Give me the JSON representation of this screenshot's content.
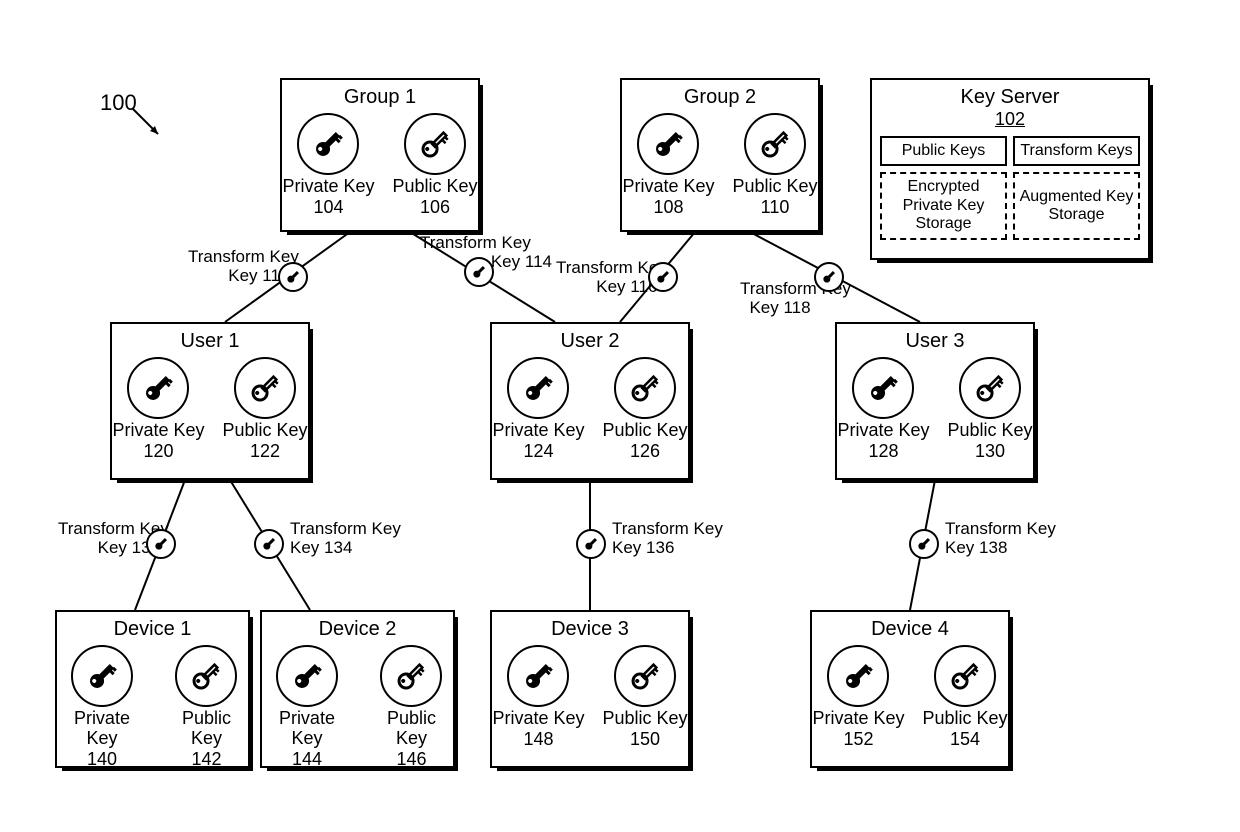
{
  "figure_number": "100",
  "key_server": {
    "title": "Key Server",
    "ref": "102",
    "cells": [
      "Public Keys",
      "Transform Keys",
      "Encrypted Private Key Storage",
      "Augmented Key Storage"
    ]
  },
  "labels": {
    "private_key": "Private Key",
    "public_key": "Public Key",
    "transform_key": "Transform Key"
  },
  "entities": {
    "group1": {
      "title": "Group 1",
      "priv": "104",
      "pub": "106"
    },
    "group2": {
      "title": "Group 2",
      "priv": "108",
      "pub": "110"
    },
    "user1": {
      "title": "User 1",
      "priv": "120",
      "pub": "122"
    },
    "user2": {
      "title": "User 2",
      "priv": "124",
      "pub": "126"
    },
    "user3": {
      "title": "User 3",
      "priv": "128",
      "pub": "130"
    },
    "device1": {
      "title": "Device 1",
      "priv": "140",
      "pub": "142"
    },
    "device2": {
      "title": "Device 2",
      "priv": "144",
      "pub": "146"
    },
    "device3": {
      "title": "Device 3",
      "priv": "148",
      "pub": "150"
    },
    "device4": {
      "title": "Device 4",
      "priv": "152",
      "pub": "154"
    }
  },
  "transform_keys": {
    "tk112": "112",
    "tk114": "114",
    "tk116": "116",
    "tk118": "118",
    "tk132": "132",
    "tk134": "134",
    "tk136": "136",
    "tk138": "138"
  }
}
